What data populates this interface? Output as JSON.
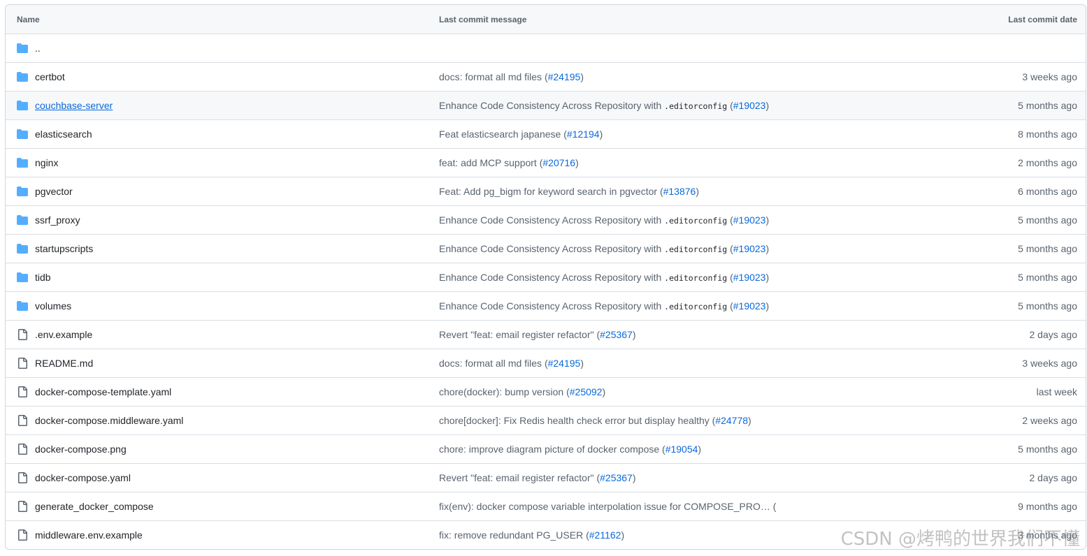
{
  "header": {
    "name": "Name",
    "message": "Last commit message",
    "date": "Last commit date"
  },
  "parent_dir": "..",
  "rows": [
    {
      "name": "certbot",
      "type": "dir",
      "msg_pre": "docs: format all md files (",
      "msg_code": "",
      "msg_post": "",
      "pr": "#24195",
      "msg_end": ")",
      "date": "3 weeks ago"
    },
    {
      "name": "couchbase-server",
      "type": "dir",
      "hover": true,
      "msg_pre": "Enhance Code Consistency Across Repository with ",
      "msg_code": ".editorconfig",
      "msg_post": " (",
      "pr": "#19023",
      "msg_end": ")",
      "date": "5 months ago"
    },
    {
      "name": "elasticsearch",
      "type": "dir",
      "msg_pre": "Feat elasticsearch japanese (",
      "msg_code": "",
      "msg_post": "",
      "pr": "#12194",
      "msg_end": ")",
      "date": "8 months ago"
    },
    {
      "name": "nginx",
      "type": "dir",
      "msg_pre": "feat: add MCP support (",
      "msg_code": "",
      "msg_post": "",
      "pr": "#20716",
      "msg_end": ")",
      "date": "2 months ago"
    },
    {
      "name": "pgvector",
      "type": "dir",
      "msg_pre": "Feat: Add pg_bigm for keyword search in pgvector (",
      "msg_code": "",
      "msg_post": "",
      "pr": "#13876",
      "msg_end": ")",
      "date": "6 months ago"
    },
    {
      "name": "ssrf_proxy",
      "type": "dir",
      "msg_pre": "Enhance Code Consistency Across Repository with ",
      "msg_code": ".editorconfig",
      "msg_post": " (",
      "pr": "#19023",
      "msg_end": ")",
      "date": "5 months ago"
    },
    {
      "name": "startupscripts",
      "type": "dir",
      "msg_pre": "Enhance Code Consistency Across Repository with ",
      "msg_code": ".editorconfig",
      "msg_post": " (",
      "pr": "#19023",
      "msg_end": ")",
      "date": "5 months ago"
    },
    {
      "name": "tidb",
      "type": "dir",
      "msg_pre": "Enhance Code Consistency Across Repository with ",
      "msg_code": ".editorconfig",
      "msg_post": " (",
      "pr": "#19023",
      "msg_end": ")",
      "date": "5 months ago"
    },
    {
      "name": "volumes",
      "type": "dir",
      "msg_pre": "Enhance Code Consistency Across Repository with ",
      "msg_code": ".editorconfig",
      "msg_post": " (",
      "pr": "#19023",
      "msg_end": ")",
      "date": "5 months ago"
    },
    {
      "name": ".env.example",
      "type": "file",
      "msg_pre": "Revert \"feat: email register refactor\" (",
      "msg_code": "",
      "msg_post": "",
      "pr": "#25367",
      "msg_end": ")",
      "date": "2 days ago"
    },
    {
      "name": "README.md",
      "type": "file",
      "msg_pre": "docs: format all md files (",
      "msg_code": "",
      "msg_post": "",
      "pr": "#24195",
      "msg_end": ")",
      "date": "3 weeks ago"
    },
    {
      "name": "docker-compose-template.yaml",
      "type": "file",
      "msg_pre": "chore(docker): bump version (",
      "msg_code": "",
      "msg_post": "",
      "pr": "#25092",
      "msg_end": ")",
      "date": "last week"
    },
    {
      "name": "docker-compose.middleware.yaml",
      "type": "file",
      "msg_pre": "chore[docker]: Fix Redis health check error but display healthy (",
      "msg_code": "",
      "msg_post": "",
      "pr": "#24778",
      "msg_end": ")",
      "date": "2 weeks ago"
    },
    {
      "name": "docker-compose.png",
      "type": "file",
      "msg_pre": "chore: improve diagram picture of docker compose (",
      "msg_code": "",
      "msg_post": "",
      "pr": "#19054",
      "msg_end": ")",
      "date": "5 months ago"
    },
    {
      "name": "docker-compose.yaml",
      "type": "file",
      "msg_pre": "Revert \"feat: email register refactor\" (",
      "msg_code": "",
      "msg_post": "",
      "pr": "#25367",
      "msg_end": ")",
      "date": "2 days ago"
    },
    {
      "name": "generate_docker_compose",
      "type": "file",
      "msg_pre": "fix(env): docker compose variable interpolation issue for COMPOSE_PRO… (",
      "msg_code": "",
      "msg_post": "",
      "pr": "",
      "msg_end": "",
      "date": "9 months ago"
    },
    {
      "name": "middleware.env.example",
      "type": "file",
      "msg_pre": "fix: remove redundant PG_USER (",
      "msg_code": "",
      "msg_post": "",
      "pr": "#21162",
      "msg_end": ")",
      "date": "3 months ago"
    }
  ],
  "watermark": "CSDN @烤鸭的世界我们不懂",
  "colors": {
    "folder": "#54aeff",
    "file_icon": "#59636e",
    "link": "#0969da"
  },
  "icons": {
    "dir": "folder-icon",
    "file": "file-icon"
  }
}
